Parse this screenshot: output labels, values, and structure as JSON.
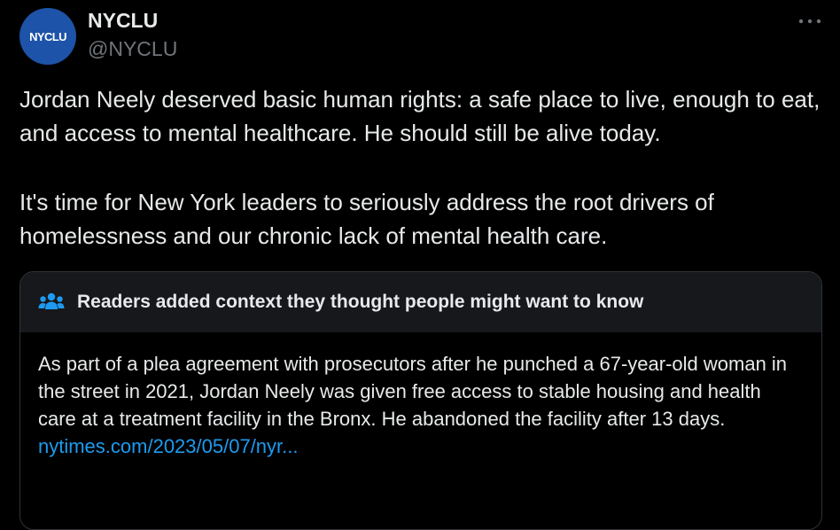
{
  "tweet": {
    "avatar_text": "NYCLU",
    "display_name": "NYCLU",
    "handle": "@NYCLU",
    "paragraphs": [
      "Jordan Neely deserved basic human rights: a safe place to live, enough to eat, and access to mental healthcare. He should still be alive today.",
      "It's time for New York leaders to seriously address the root drivers of homelessness and our chronic lack of mental health care."
    ]
  },
  "community_note": {
    "header": "Readers added context they thought people might want to know",
    "header_icon": "people-icon",
    "body": "As part of a plea agreement with prosecutors after he punched a 67-year-old woman in the street in 2021, Jordan Neely was given free access to stable housing and health care at a treatment facility in the Bronx. He abandoned the facility after 13 days.",
    "link": "nytimes.com/2023/05/07/nyr..."
  },
  "colors": {
    "background": "#000000",
    "text": "#e7e9ea",
    "secondary_text": "#71767b",
    "link": "#1d9bf0",
    "avatar": "#1d53a8",
    "note_header_bg": "#16181c",
    "border": "#2f3336"
  },
  "icons": {
    "more": "more-horizontal-icon",
    "note_header": "people-icon"
  }
}
